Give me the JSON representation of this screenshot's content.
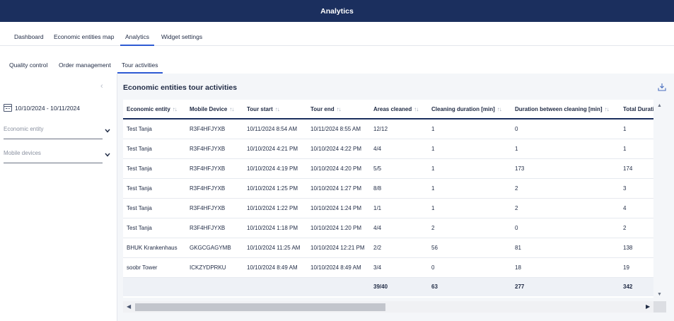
{
  "header": {
    "title": "Analytics"
  },
  "nav_primary": [
    {
      "label": "Dashboard"
    },
    {
      "label": "Economic entities map"
    },
    {
      "label": "Analytics"
    },
    {
      "label": "Widget settings"
    }
  ],
  "nav_secondary": [
    {
      "label": "Quality control"
    },
    {
      "label": "Order management"
    },
    {
      "label": "Tour activities"
    }
  ],
  "sidebar": {
    "collapse_glyph": "‹",
    "date_range": "10/10/2024 - 10/11/2024",
    "economic_entity_placeholder": "Economic entity",
    "mobile_devices_placeholder": "Mobile devices"
  },
  "content": {
    "title": "Economic entities tour activities",
    "download_icon": "download-icon"
  },
  "table": {
    "sort_glyph": "↑↓",
    "columns": [
      "Economic entity",
      "Mobile Device",
      "Tour start",
      "Tour end",
      "Areas cleaned",
      "Cleaning duration [min]",
      "Duration between cleaning [min]",
      "Total Duration [min]"
    ],
    "rows": [
      [
        "Test Tanja",
        "R3F4HFJYXB",
        "10/11/2024 8:54 AM",
        "10/11/2024 8:55 AM",
        "12/12",
        "1",
        "0",
        "1"
      ],
      [
        "Test Tanja",
        "R3F4HFJYXB",
        "10/10/2024 4:21 PM",
        "10/10/2024 4:22 PM",
        "4/4",
        "1",
        "1",
        "1"
      ],
      [
        "Test Tanja",
        "R3F4HFJYXB",
        "10/10/2024 4:19 PM",
        "10/10/2024 4:20 PM",
        "5/5",
        "1",
        "173",
        "174"
      ],
      [
        "Test Tanja",
        "R3F4HFJYXB",
        "10/10/2024 1:25 PM",
        "10/10/2024 1:27 PM",
        "8/8",
        "1",
        "2",
        "3"
      ],
      [
        "Test Tanja",
        "R3F4HFJYXB",
        "10/10/2024 1:22 PM",
        "10/10/2024 1:24 PM",
        "1/1",
        "1",
        "2",
        "4"
      ],
      [
        "Test Tanja",
        "R3F4HFJYXB",
        "10/10/2024 1:18 PM",
        "10/10/2024 1:20 PM",
        "4/4",
        "2",
        "0",
        "2"
      ],
      [
        "BHUK Krankenhaus",
        "GKGCGAGYMB",
        "10/10/2024 11:25 AM",
        "10/10/2024 12:21 PM",
        "2/2",
        "56",
        "81",
        "138"
      ],
      [
        "soobr Tower",
        "ICKZYDPRKU",
        "10/10/2024 8:49 AM",
        "10/10/2024 8:49 AM",
        "3/4",
        "0",
        "18",
        "19"
      ]
    ],
    "footer": [
      "",
      "",
      "",
      "",
      "39/40",
      "63",
      "277",
      "342"
    ]
  },
  "colors": {
    "header_bg": "#1b2f5e",
    "accent": "#2e5bd3"
  }
}
